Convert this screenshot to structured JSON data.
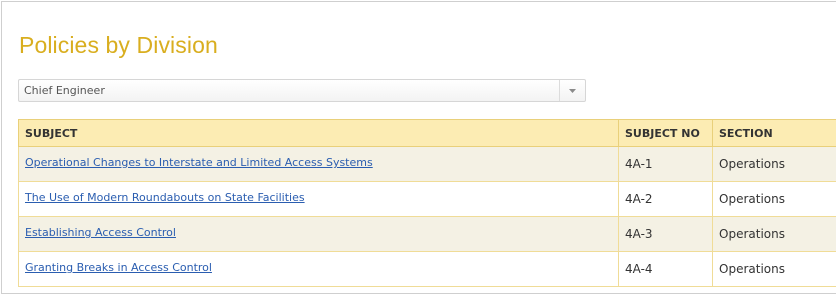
{
  "page": {
    "title": "Policies by Division"
  },
  "division_filter": {
    "selected": "Chief Engineer",
    "icon": "chevron-down-icon"
  },
  "table": {
    "headers": [
      "SUBJECT",
      "SUBJECT NO",
      "SECTION"
    ],
    "rows": [
      {
        "subject": "Operational Changes to Interstate and Limited Access Systems",
        "subject_no": "4A-1",
        "section": "Operations"
      },
      {
        "subject": "The Use of Modern Roundabouts on State Facilities",
        "subject_no": "4A-2",
        "section": "Operations"
      },
      {
        "subject": "Establishing Access Control",
        "subject_no": "4A-3",
        "section": "Operations"
      },
      {
        "subject": "Granting Breaks in Access Control",
        "subject_no": "4A-4",
        "section": "Operations"
      }
    ]
  },
  "colors": {
    "title": "#d9ae1f",
    "header_bg": "#fcecb3",
    "row_shade": "#f4f1e4",
    "link": "#2a5db0",
    "border": "#f0dc97"
  }
}
